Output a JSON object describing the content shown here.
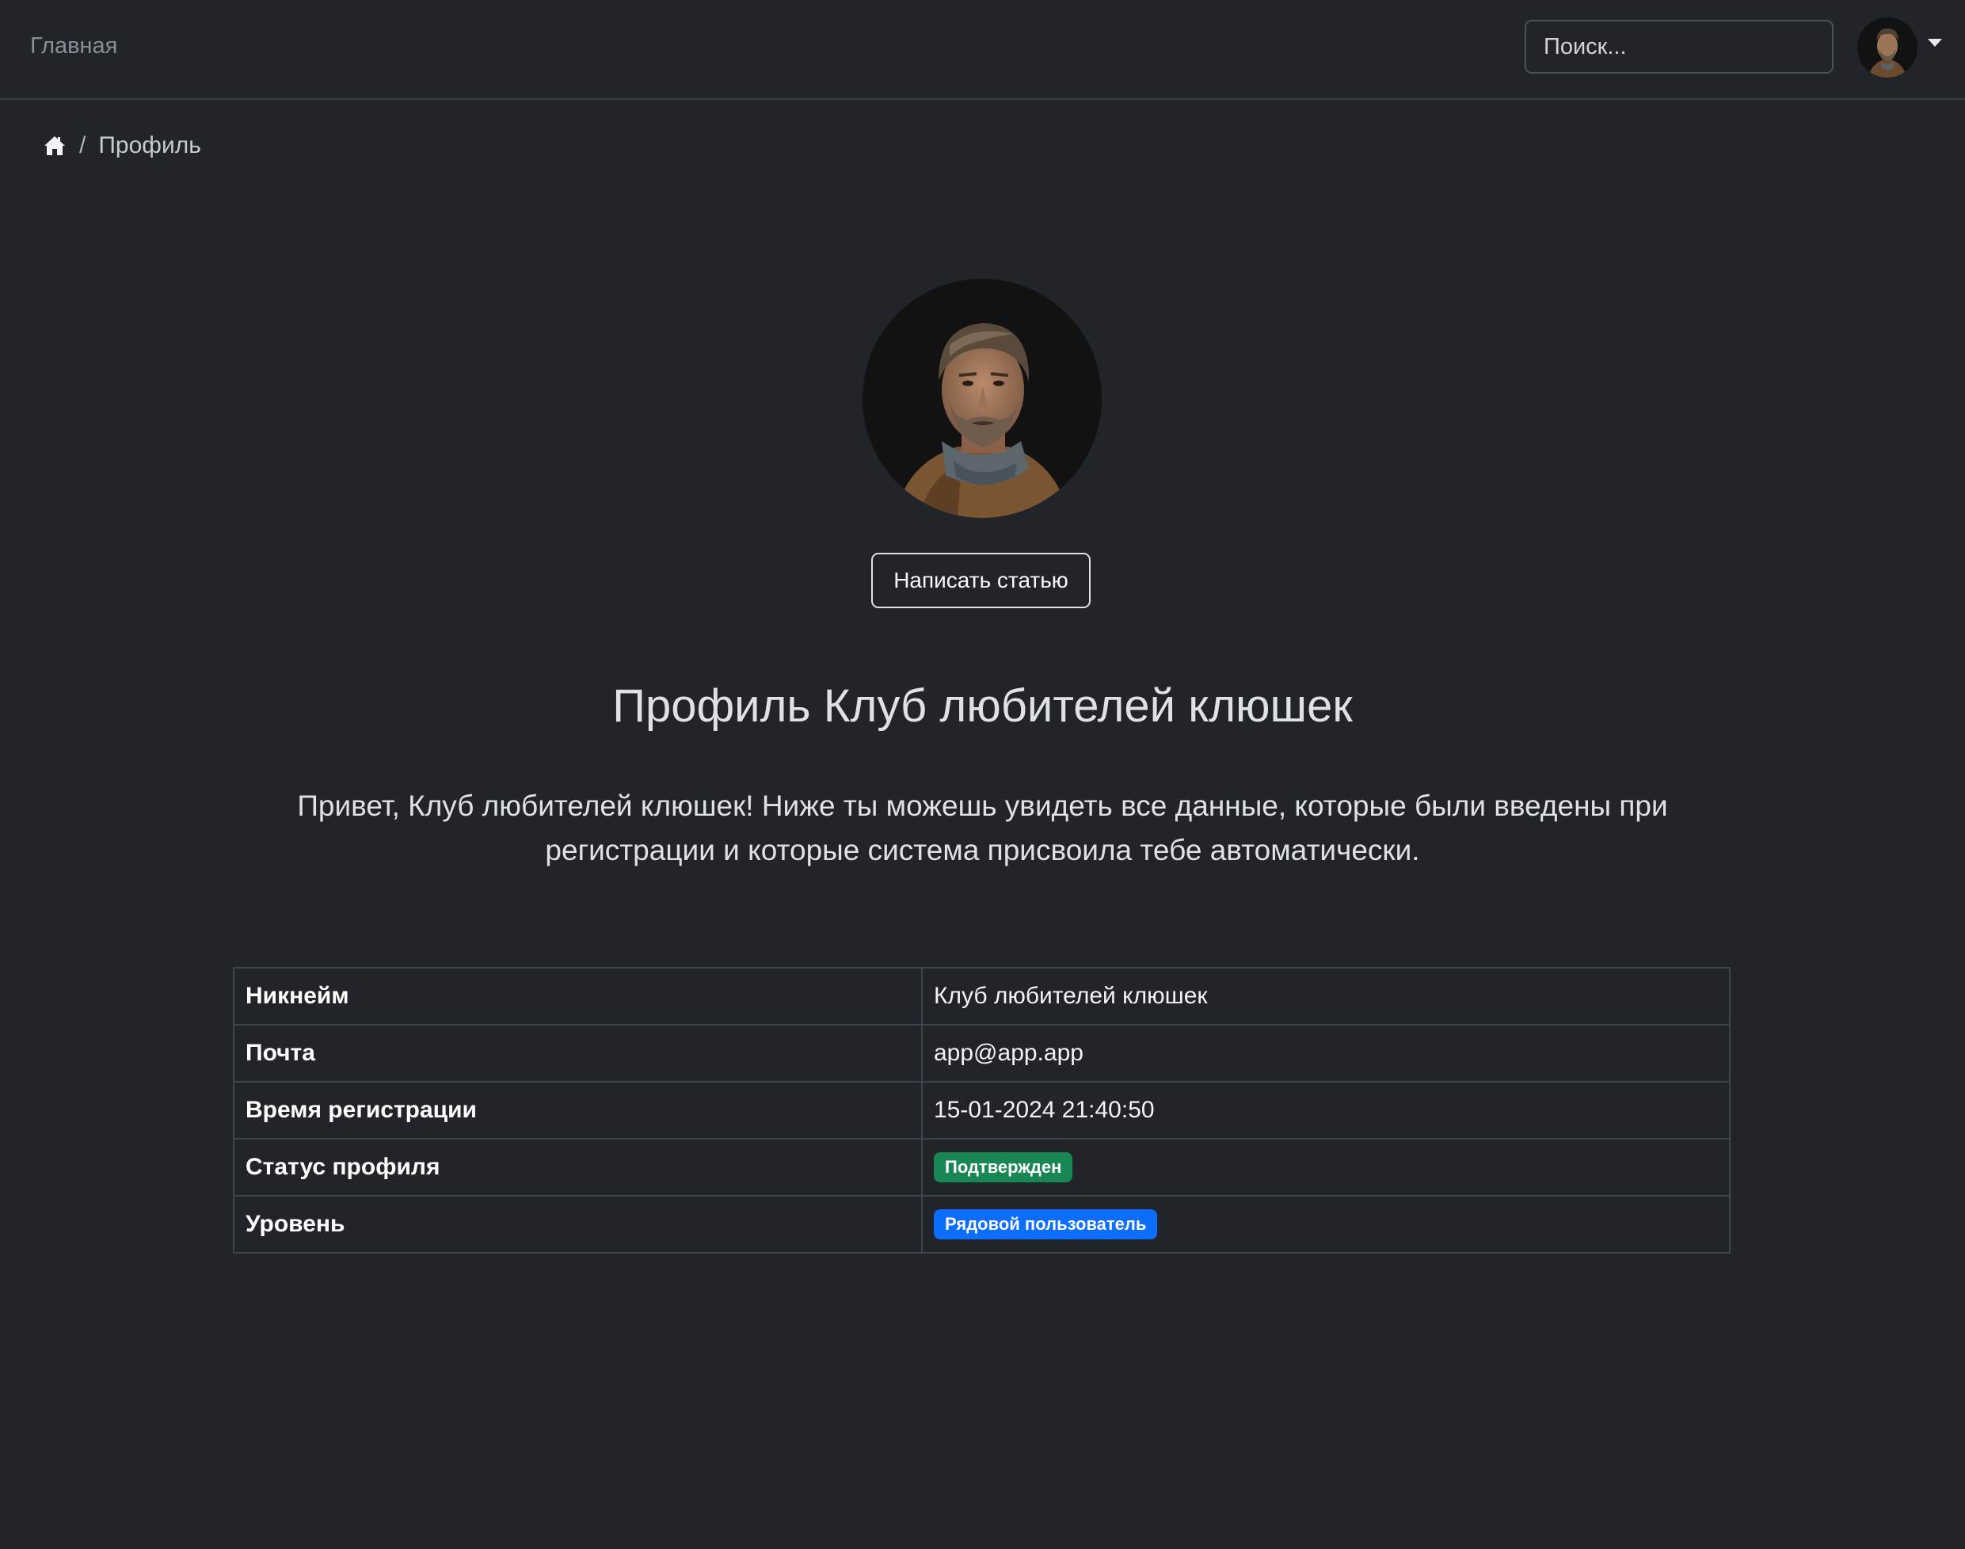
{
  "navbar": {
    "home_link": "Главная",
    "search_placeholder": "Поиск..."
  },
  "breadcrumb": {
    "current": "Профиль",
    "separator": "/"
  },
  "profile": {
    "write_button": "Написать статью",
    "title": "Профиль Клуб любителей клюшек",
    "lead": "Привет, Клуб любителей клюшек! Ниже ты можешь увидеть все данные, которые были введены при регистрации и которые система присвоила тебе автоматически."
  },
  "table": {
    "rows": [
      {
        "label": "Никнейм",
        "value": "Клуб любителей клюшек"
      },
      {
        "label": "Почта",
        "value": "app@app.app"
      },
      {
        "label": "Время регистрации",
        "value": "15-01-2024 21:40:50"
      },
      {
        "label": "Статус профиля",
        "badge": "Подтвержден",
        "badge_color": "#198754"
      },
      {
        "label": "Уровень",
        "badge": "Рядовой пользователь",
        "badge_color": "#0d6efd"
      }
    ]
  },
  "colors": {
    "background": "#212529",
    "success": "#198754",
    "primary": "#0d6efd"
  },
  "icons": {
    "breadcrumb_home": "home-icon",
    "user_menu": "chevron-down-icon"
  }
}
